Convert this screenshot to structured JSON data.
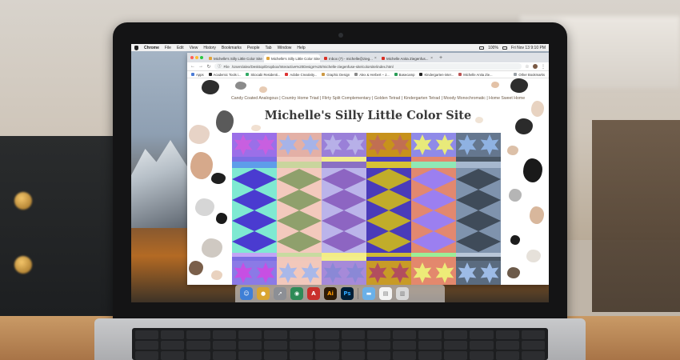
{
  "menubar": {
    "app": "Chrome",
    "items": [
      "File",
      "Edit",
      "View",
      "History",
      "Bookmarks",
      "People",
      "Tab",
      "Window",
      "Help"
    ],
    "battery": "100%",
    "datetime": "Fri Nov 13  9:10 PM"
  },
  "browser": {
    "tabs": [
      {
        "title": "Michelle's Silly Little Color Site",
        "favicon_color": "#e0a33a",
        "active": false
      },
      {
        "title": "Michelle's Silly Little Color Site",
        "favicon_color": "#e0a33a",
        "active": true
      },
      {
        "title": "Inbox (7) - michelle@zieg...",
        "favicon_color": "#d93025",
        "active": false
      },
      {
        "title": "Michelle Anita Ziegenfus...",
        "favicon_color": "#d93025",
        "active": false
      }
    ],
    "new_tab": "+",
    "url_prefix": "File",
    "url": "/Users/alex/Desktop/Dropbox/Interactive%20Design%20/michelle-ziegenfuse-site/colorsite/index.html",
    "bookmarks": [
      {
        "label": "Apps",
        "color": "#4b7bd6"
      },
      {
        "label": "Academic Tools i...",
        "color": "#222"
      },
      {
        "label": "Stiocabi Residenti...",
        "color": "#3a6"
      },
      {
        "label": "Adobe Creativity...",
        "color": "#d33"
      },
      {
        "label": "Graphic Design",
        "color": "#c94"
      },
      {
        "label": "Alex & Herbert – J...",
        "color": "#888"
      },
      {
        "label": "Basecamp",
        "color": "#2a9d57"
      },
      {
        "label": "Kindergarten-inter...",
        "color": "#222"
      },
      {
        "label": "Michelle Anita Zie...",
        "color": "#b55"
      }
    ],
    "other_bookmarks": "Other Bookmarks"
  },
  "site": {
    "title": "Michelle's Silly Little Color Site",
    "nav": [
      "Candy Coated Analogous",
      "Country Home Triad",
      "Flirty Split Complementary",
      "Golden Tetrad",
      "Kindergarten Tetrad",
      "Moody Monochromatic",
      "Home Sweet Home"
    ],
    "nav_separator": "|",
    "palettes": [
      {
        "name": "Candy Coated Analogous",
        "top": "#9b6fe8",
        "star": "#c85fe0",
        "band1": "#7b6ee4",
        "band2": "#5e9dea",
        "diamond": "#4a3bd0",
        "diamond_bg": "#7fe9d2",
        "stripe": "#c1a4f5",
        "bottom": "#8b7ae6",
        "bottom_star": "#c74fe3"
      },
      {
        "name": "Country Home Triad",
        "top": "#e3b0a6",
        "star": "#a6b3e8",
        "band1": "#f0c8bb",
        "band2": "#c9d59d",
        "diamond": "#8fa06c",
        "diamond_bg": "#f3c9bd",
        "stripe": "#c8dba0",
        "bottom": "#f2c8bb",
        "bottom_star": "#a9b8e9"
      },
      {
        "name": "Flirty Split Complementary",
        "top": "#9a80d8",
        "star": "#b7b0e8",
        "band1": "#f2ee8c",
        "band2": "#8a6fc4",
        "diamond": "#8d65c2",
        "diamond_bg": "#bbb4ea",
        "stripe": "#f3ec86",
        "bottom": "#a68ad9",
        "bottom_star": "#8a88d6"
      },
      {
        "name": "Golden Tetrad",
        "top": "#c7921c",
        "star": "#c16f52",
        "band1": "#4d3fc0",
        "band2": "#d7c234",
        "diamond": "#c1ad2a",
        "diamond_bg": "#4a3bb9",
        "stripe": "#cfbb34",
        "bottom": "#c89b27",
        "bottom_star": "#b24e5e"
      },
      {
        "name": "Kindergarten Tetrad",
        "top": "#8f8ae8",
        "star": "#e8ea7a",
        "band1": "#e3876d",
        "band2": "#8fe8b6",
        "diamond": "#9b7ff0",
        "diamond_bg": "#e2886f",
        "stripe": "#9bee98",
        "bottom": "#e3886d",
        "bottom_star": "#edeb78"
      },
      {
        "name": "Moody Monochromatic",
        "top": "#65778f",
        "star": "#8fb2e2",
        "band1": "#4a5765",
        "band2": "#a6b8cf",
        "diamond": "#3f4b59",
        "diamond_bg": "#7f93ad",
        "stripe": "#b9c7d8",
        "bottom": "#5a6b7f",
        "bottom_star": "#9dbbe6"
      }
    ]
  },
  "dock": [
    {
      "name": "finder-icon",
      "color": "#3f7fd6",
      "glyph": "☺"
    },
    {
      "name": "chrome-icon",
      "color": "#d9a531",
      "glyph": "●"
    },
    {
      "name": "launchpad-icon",
      "color": "#8c8f95",
      "glyph": "➚"
    },
    {
      "name": "spotify-icon",
      "color": "#2e8b57",
      "glyph": "◉"
    },
    {
      "name": "acrobat-icon",
      "color": "#c9302c",
      "glyph": "A"
    },
    {
      "name": "illustrator-icon",
      "color": "#2d1a05",
      "glyph": "Ai",
      "fg": "#ff9a00"
    },
    {
      "name": "photoshop-icon",
      "color": "#001e36",
      "glyph": "Ps",
      "fg": "#31a8ff"
    },
    {
      "name": "folder-icon",
      "color": "#6ab0e8",
      "glyph": "▬"
    },
    {
      "name": "document-icon",
      "color": "#f4f4f4",
      "glyph": "▤",
      "fg": "#777"
    },
    {
      "name": "trash-icon",
      "color": "#d8d8d8",
      "glyph": "▥",
      "fg": "#777"
    }
  ]
}
